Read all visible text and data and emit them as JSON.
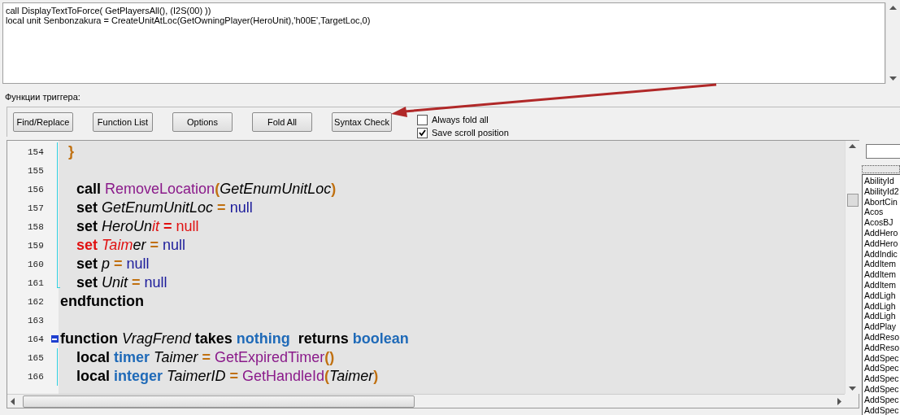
{
  "script_box": {
    "lines": [
      "call DisplayTextToForce( GetPlayersAll(), (I2S(00) ))",
      "local unit Senbonzakura = CreateUnitAtLoc(GetOwningPlayer(HeroUnit),'h00E',TargetLoc,0)"
    ]
  },
  "section_label": "Функции триггера:",
  "toolbar": {
    "buttons": [
      "Find/Replace",
      "Function List",
      "Options",
      "Fold All",
      "Syntax Check"
    ],
    "checkboxes": [
      {
        "label": "Always fold all",
        "checked": false
      },
      {
        "label": "Save scroll position",
        "checked": true
      }
    ]
  },
  "editor": {
    "lines": [
      {
        "number": "154",
        "kind": "line",
        "tokens": [
          {
            "text": "  }",
            "kind": "op"
          }
        ]
      },
      {
        "number": "155",
        "kind": "line"
      },
      {
        "number": "156",
        "kind": "line",
        "tokens": [
          {
            "text": "    call ",
            "kind": "kw"
          },
          {
            "text": "RemoveLocation",
            "kind": "native"
          },
          {
            "text": "(",
            "kind": "op"
          },
          {
            "text": "GetEnumUnitLoc",
            "kind": "ident"
          },
          {
            "text": ")",
            "kind": "op"
          }
        ]
      },
      {
        "number": "157",
        "kind": "line",
        "tokens": [
          {
            "text": "    set ",
            "kind": "kw"
          },
          {
            "text": "GetEnumUnitLoc ",
            "kind": "ident"
          },
          {
            "text": "= ",
            "kind": "op"
          },
          {
            "text": "null",
            "kind": "null"
          }
        ]
      },
      {
        "number": "158",
        "kind": "line",
        "tokens": [
          {
            "text": "    set ",
            "kind": "kw"
          },
          {
            "text": "HeroUn",
            "kind": "ident"
          },
          {
            "text": "it ",
            "kind": "err_ident"
          },
          {
            "text": "= ",
            "kind": "err_op"
          },
          {
            "text": "null",
            "kind": "err"
          }
        ]
      },
      {
        "number": "159",
        "kind": "line",
        "tokens": [
          {
            "text": "    set ",
            "kind": "err_kw"
          },
          {
            "text": "Taim",
            "kind": "err_ident"
          },
          {
            "text": "er ",
            "kind": "ident"
          },
          {
            "text": "= ",
            "kind": "op"
          },
          {
            "text": "null",
            "kind": "null"
          }
        ]
      },
      {
        "number": "160",
        "kind": "line",
        "tokens": [
          {
            "text": "    set ",
            "kind": "kw"
          },
          {
            "text": "p ",
            "kind": "ident"
          },
          {
            "text": "= ",
            "kind": "op"
          },
          {
            "text": "null",
            "kind": "null"
          }
        ]
      },
      {
        "number": "161",
        "kind": "end",
        "tokens": [
          {
            "text": "    set ",
            "kind": "kw"
          },
          {
            "text": "Unit ",
            "kind": "ident"
          },
          {
            "text": "= ",
            "kind": "op"
          },
          {
            "text": "null",
            "kind": "null"
          }
        ]
      },
      {
        "number": "162",
        "kind": "plain",
        "tokens": [
          {
            "text": "endfunction",
            "kind": "kw"
          }
        ]
      },
      {
        "number": "163",
        "kind": "plain"
      },
      {
        "number": "164",
        "kind": "start",
        "tokens": [
          {
            "text": "function ",
            "kind": "kw"
          },
          {
            "text": "VragFrend ",
            "kind": "ident"
          },
          {
            "text": "takes ",
            "kind": "kw"
          },
          {
            "text": "nothing",
            "kind": "type"
          },
          {
            "text": "  returns ",
            "kind": "kw"
          },
          {
            "text": "boolean",
            "kind": "type"
          }
        ]
      },
      {
        "number": "165",
        "kind": "line",
        "tokens": [
          {
            "text": "    local ",
            "kind": "kw"
          },
          {
            "text": "timer ",
            "kind": "type"
          },
          {
            "text": "Taimer ",
            "kind": "ident"
          },
          {
            "text": "= ",
            "kind": "op"
          },
          {
            "text": "GetExpiredTimer",
            "kind": "native"
          },
          {
            "text": "()",
            "kind": "op"
          }
        ]
      },
      {
        "number": "166",
        "kind": "line",
        "tokens": [
          {
            "text": "    local ",
            "kind": "kw"
          },
          {
            "text": "integer ",
            "kind": "type"
          },
          {
            "text": "TaimerID ",
            "kind": "ident"
          },
          {
            "text": "= ",
            "kind": "op"
          },
          {
            "text": "GetHandleId",
            "kind": "native"
          },
          {
            "text": "(",
            "kind": "op"
          },
          {
            "text": "Taimer",
            "kind": "ident"
          },
          {
            "text": ")",
            "kind": "op"
          }
        ]
      }
    ]
  },
  "function_list": {
    "items": [
      "AbilityId",
      "AbilityId2",
      "AbortCin",
      "Acos",
      "AcosBJ",
      "AddHero",
      "AddHero",
      "AddIndic",
      "AddItem",
      "AddItem",
      "AddItem",
      "AddLigh",
      "AddLigh",
      "AddLigh",
      "AddPlay",
      "AddReso",
      "AddReso",
      "AddSpec",
      "AddSpec",
      "AddSpec",
      "AddSpec",
      "AddSpec",
      "AddSpec"
    ]
  }
}
